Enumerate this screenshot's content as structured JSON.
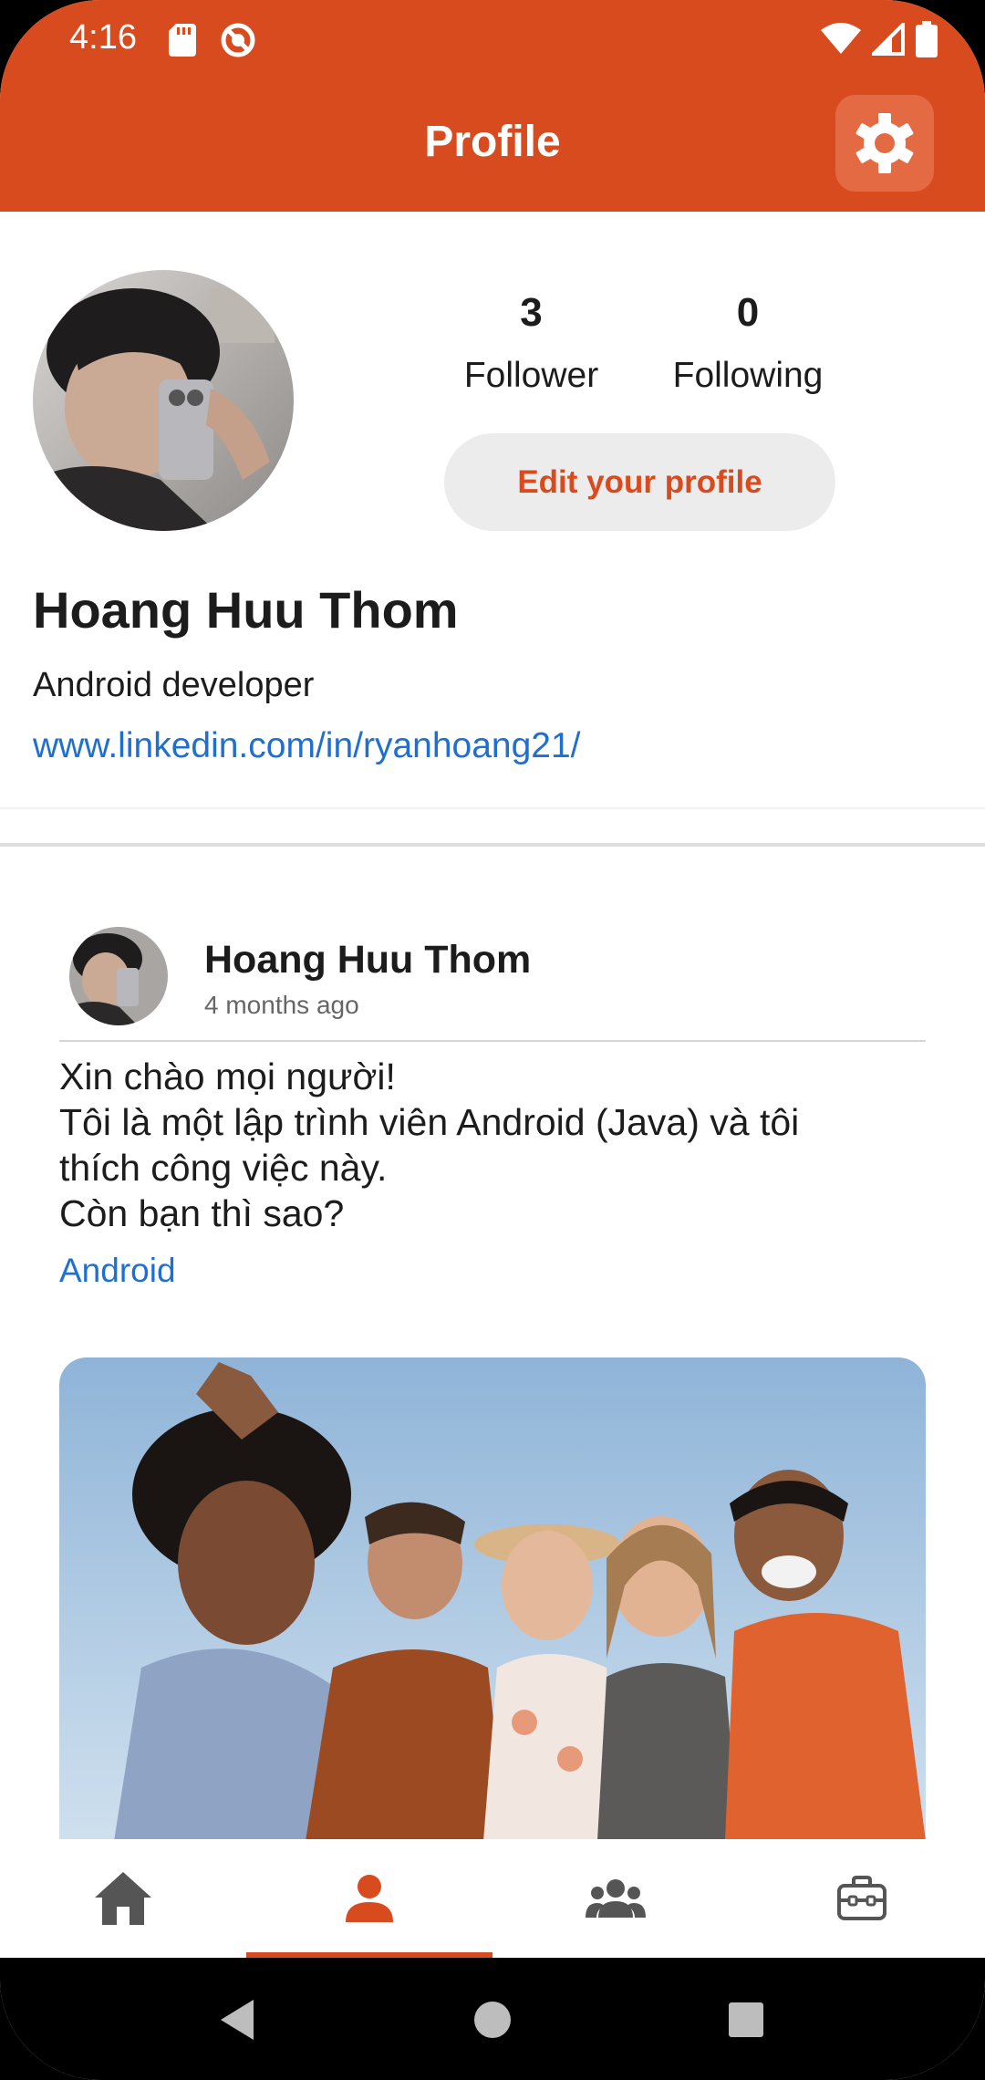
{
  "status_bar": {
    "time": "4:16"
  },
  "app_bar": {
    "title": "Profile"
  },
  "profile": {
    "followers_count": "3",
    "followers_label": "Follower",
    "following_count": "0",
    "following_label": "Following",
    "edit_button_label": "Edit your profile",
    "name": "Hoang Huu Thom",
    "bio": "Android developer",
    "link": "www.linkedin.com/in/ryanhoang21/"
  },
  "post": {
    "author": "Hoang Huu Thom",
    "time": "4 months ago",
    "lines": [
      "Xin chào mọi người!",
      "Tôi là một lập trình viên Android (Java) và tôi",
      "thích công việc này.",
      "Còn bạn thì sao?"
    ],
    "tag": "Android"
  },
  "bottom_nav": {
    "items": [
      {
        "icon": "home-icon"
      },
      {
        "icon": "person-icon",
        "selected": true
      },
      {
        "icon": "group-icon"
      },
      {
        "icon": "briefcase-icon"
      }
    ]
  },
  "colors": {
    "primary": "#d84b1e",
    "link": "#1f6fd1",
    "edit_button_bg": "#ececec"
  }
}
